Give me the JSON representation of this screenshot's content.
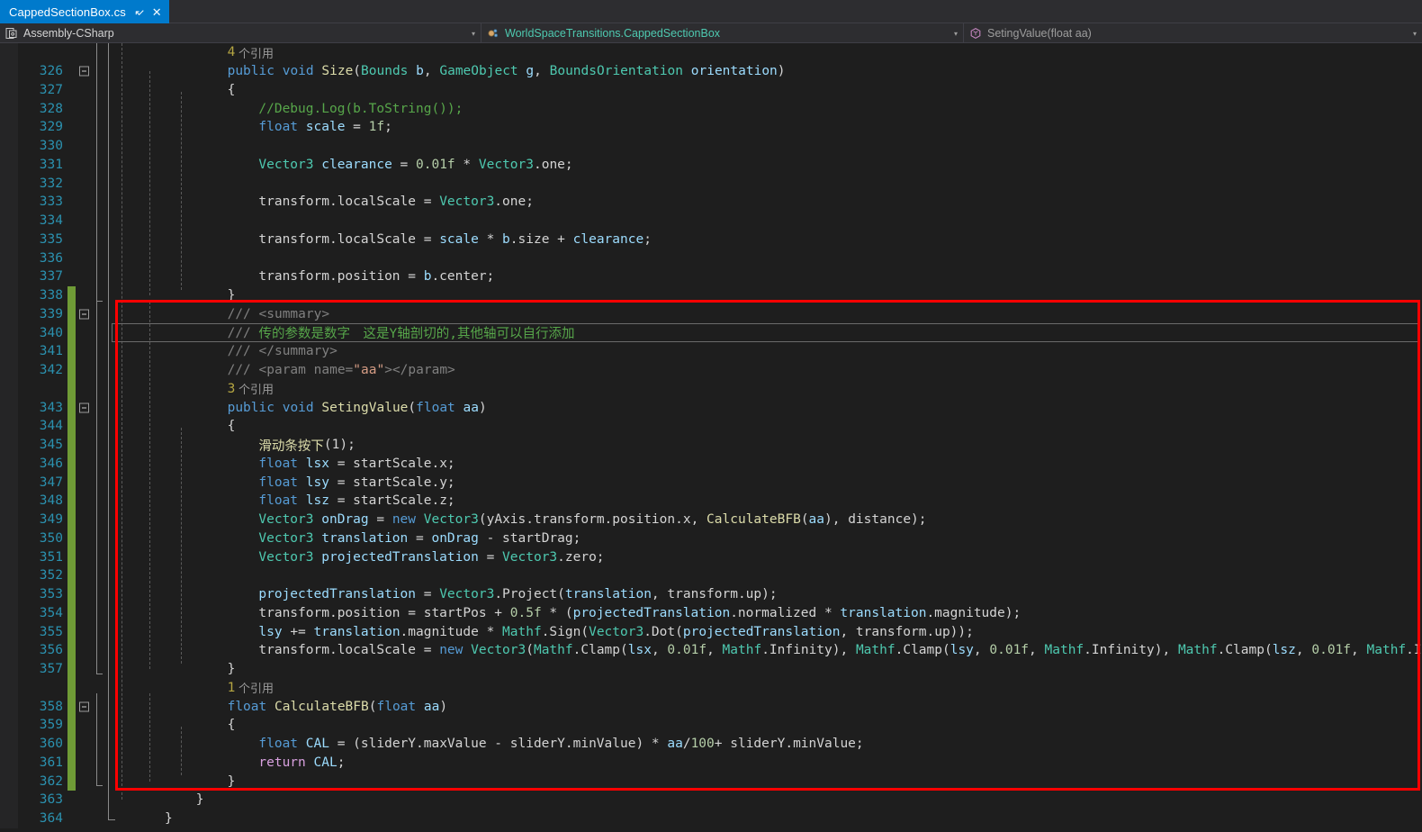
{
  "tab": {
    "label": "CappedSectionBox.cs",
    "pin_icon": "pin-icon",
    "close_icon": "close-icon",
    "close_glyph": "✕",
    "pin_glyph": "↲"
  },
  "navbar": {
    "project": "Assembly-CSharp",
    "type": "WorldSpaceTransitions.CappedSectionBox",
    "member": "SetingValue(float aa)",
    "dropdown_glyph": "▾"
  },
  "colors": {
    "accent": "#007acc",
    "chrome": "#2d2d30",
    "editor_bg": "#1e1e1e",
    "gutter_bg": "#252526",
    "line_number": "#2b91af",
    "annotation_red": "#ff0000",
    "change_green": "#6f9b36",
    "comment_green": "#57a64a",
    "keyword_blue": "#569cd6",
    "type_teal": "#4ec9b0",
    "method_tan": "#dcdcaa",
    "local_lightblue": "#9cdcfe",
    "number_olive": "#b5cea8",
    "string_salmon": "#d69d85",
    "control_violet": "#d8a0df"
  },
  "editor": {
    "first_visible_line": 326,
    "last_visible_line": 364,
    "lines": [
      {
        "n": "",
        "kind": "codelens",
        "text": "4 个引用",
        "count": "4",
        "indent": 2
      },
      {
        "n": "326",
        "kind": "code",
        "fold": true,
        "indent": 2,
        "tokens": [
          [
            "kw",
            "public"
          ],
          [
            "pln",
            " "
          ],
          [
            "kw",
            "void"
          ],
          [
            "pln",
            " "
          ],
          [
            "fn",
            "Size"
          ],
          [
            "pln",
            "("
          ],
          [
            "type",
            "Bounds"
          ],
          [
            "pln",
            " "
          ],
          [
            "var",
            "b"
          ],
          [
            "pln",
            ", "
          ],
          [
            "type",
            "GameObject"
          ],
          [
            "pln",
            " "
          ],
          [
            "var",
            "g"
          ],
          [
            "pln",
            ", "
          ],
          [
            "type",
            "BoundsOrientation"
          ],
          [
            "pln",
            " "
          ],
          [
            "var",
            "orientation"
          ],
          [
            "pln",
            ")"
          ]
        ]
      },
      {
        "n": "327",
        "kind": "code",
        "indent": 2,
        "tokens": [
          [
            "pln",
            "{"
          ]
        ]
      },
      {
        "n": "328",
        "kind": "code",
        "indent": 3,
        "tokens": [
          [
            "cmt",
            "//Debug.Log(b.ToString());"
          ]
        ]
      },
      {
        "n": "329",
        "kind": "code",
        "indent": 3,
        "tokens": [
          [
            "kw",
            "float"
          ],
          [
            "pln",
            " "
          ],
          [
            "var",
            "scale"
          ],
          [
            "pln",
            " = "
          ],
          [
            "num",
            "1f"
          ],
          [
            "pln",
            ";"
          ]
        ]
      },
      {
        "n": "330",
        "kind": "code",
        "indent": 3,
        "tokens": []
      },
      {
        "n": "331",
        "kind": "code",
        "indent": 3,
        "tokens": [
          [
            "type",
            "Vector3"
          ],
          [
            "pln",
            " "
          ],
          [
            "var",
            "clearance"
          ],
          [
            "pln",
            " = "
          ],
          [
            "num",
            "0.01f"
          ],
          [
            "pln",
            " * "
          ],
          [
            "type",
            "Vector3"
          ],
          [
            "pln",
            ".one;"
          ]
        ]
      },
      {
        "n": "332",
        "kind": "code",
        "indent": 3,
        "tokens": []
      },
      {
        "n": "333",
        "kind": "code",
        "indent": 3,
        "tokens": [
          [
            "pln",
            "transform.localScale = "
          ],
          [
            "type",
            "Vector3"
          ],
          [
            "pln",
            ".one;"
          ]
        ]
      },
      {
        "n": "334",
        "kind": "code",
        "indent": 3,
        "tokens": []
      },
      {
        "n": "335",
        "kind": "code",
        "indent": 3,
        "tokens": [
          [
            "pln",
            "transform.localScale = "
          ],
          [
            "var",
            "scale"
          ],
          [
            "pln",
            " * "
          ],
          [
            "var",
            "b"
          ],
          [
            "pln",
            ".size + "
          ],
          [
            "var",
            "clearance"
          ],
          [
            "pln",
            ";"
          ]
        ]
      },
      {
        "n": "336",
        "kind": "code",
        "indent": 3,
        "tokens": []
      },
      {
        "n": "337",
        "kind": "code",
        "indent": 3,
        "tokens": [
          [
            "pln",
            "transform.position = "
          ],
          [
            "var",
            "b"
          ],
          [
            "pln",
            ".center;"
          ]
        ]
      },
      {
        "n": "338",
        "kind": "code",
        "indent": 2,
        "tokens": [
          [
            "pln",
            "}"
          ]
        ]
      },
      {
        "n": "339",
        "kind": "code",
        "fold": true,
        "indent": 2,
        "tokens": [
          [
            "doctag",
            "/// "
          ],
          [
            "doctag",
            "<summary>"
          ]
        ]
      },
      {
        "n": "340",
        "kind": "code",
        "indent": 2,
        "current": true,
        "tokens": [
          [
            "doctag",
            "/// "
          ],
          [
            "doc",
            "传的参数是数字　这是Y轴剖切的,其他轴可以自行添加"
          ]
        ]
      },
      {
        "n": "341",
        "kind": "code",
        "indent": 2,
        "tokens": [
          [
            "doctag",
            "/// "
          ],
          [
            "doctag",
            "</summary>"
          ]
        ]
      },
      {
        "n": "342",
        "kind": "code",
        "indent": 2,
        "tokens": [
          [
            "doctag",
            "/// "
          ],
          [
            "doctag",
            "<param name="
          ],
          [
            "str",
            "\"aa\""
          ],
          [
            "doctag",
            ">"
          ],
          [
            "doctag",
            "</param>"
          ]
        ]
      },
      {
        "n": "",
        "kind": "codelens",
        "text": "3 个引用",
        "count": "3",
        "indent": 2
      },
      {
        "n": "343",
        "kind": "code",
        "fold": true,
        "indent": 2,
        "tokens": [
          [
            "kw",
            "public"
          ],
          [
            "pln",
            " "
          ],
          [
            "kw",
            "void"
          ],
          [
            "pln",
            " "
          ],
          [
            "fn",
            "SetingValue"
          ],
          [
            "pln",
            "("
          ],
          [
            "kw",
            "float"
          ],
          [
            "pln",
            " "
          ],
          [
            "var",
            "aa"
          ],
          [
            "pln",
            ")"
          ]
        ]
      },
      {
        "n": "344",
        "kind": "code",
        "indent": 2,
        "tokens": [
          [
            "pln",
            "{"
          ]
        ]
      },
      {
        "n": "345",
        "kind": "code",
        "indent": 3,
        "tokens": [
          [
            "fn",
            "滑动条按下"
          ],
          [
            "pln",
            "(1);"
          ]
        ]
      },
      {
        "n": "346",
        "kind": "code",
        "indent": 3,
        "tokens": [
          [
            "kw",
            "float"
          ],
          [
            "pln",
            " "
          ],
          [
            "var",
            "lsx"
          ],
          [
            "pln",
            " = startScale.x;"
          ]
        ]
      },
      {
        "n": "347",
        "kind": "code",
        "indent": 3,
        "tokens": [
          [
            "kw",
            "float"
          ],
          [
            "pln",
            " "
          ],
          [
            "var",
            "lsy"
          ],
          [
            "pln",
            " = startScale.y;"
          ]
        ]
      },
      {
        "n": "348",
        "kind": "code",
        "indent": 3,
        "tokens": [
          [
            "kw",
            "float"
          ],
          [
            "pln",
            " "
          ],
          [
            "var",
            "lsz"
          ],
          [
            "pln",
            " = startScale.z;"
          ]
        ]
      },
      {
        "n": "349",
        "kind": "code",
        "indent": 3,
        "tokens": [
          [
            "type",
            "Vector3"
          ],
          [
            "pln",
            " "
          ],
          [
            "var",
            "onDrag"
          ],
          [
            "pln",
            " = "
          ],
          [
            "kw",
            "new"
          ],
          [
            "pln",
            " "
          ],
          [
            "type",
            "Vector3"
          ],
          [
            "pln",
            "(yAxis.transform.position.x, "
          ],
          [
            "fn",
            "CalculateBFB"
          ],
          [
            "pln",
            "("
          ],
          [
            "var",
            "aa"
          ],
          [
            "pln",
            "), distance);"
          ]
        ]
      },
      {
        "n": "350",
        "kind": "code",
        "indent": 3,
        "tokens": [
          [
            "type",
            "Vector3"
          ],
          [
            "pln",
            " "
          ],
          [
            "var",
            "translation"
          ],
          [
            "pln",
            " = "
          ],
          [
            "var",
            "onDrag"
          ],
          [
            "pln",
            " - startDrag;"
          ]
        ]
      },
      {
        "n": "351",
        "kind": "code",
        "indent": 3,
        "tokens": [
          [
            "type",
            "Vector3"
          ],
          [
            "pln",
            " "
          ],
          [
            "var",
            "projectedTranslation"
          ],
          [
            "pln",
            " = "
          ],
          [
            "type",
            "Vector3"
          ],
          [
            "pln",
            ".zero;"
          ]
        ]
      },
      {
        "n": "352",
        "kind": "code",
        "indent": 3,
        "tokens": []
      },
      {
        "n": "353",
        "kind": "code",
        "indent": 3,
        "tokens": [
          [
            "var",
            "projectedTranslation"
          ],
          [
            "pln",
            " = "
          ],
          [
            "type",
            "Vector3"
          ],
          [
            "pln",
            ".Project("
          ],
          [
            "var",
            "translation"
          ],
          [
            "pln",
            ", transform.up);"
          ]
        ]
      },
      {
        "n": "354",
        "kind": "code",
        "indent": 3,
        "tokens": [
          [
            "pln",
            "transform.position = startPos + "
          ],
          [
            "num",
            "0.5f"
          ],
          [
            "pln",
            " * ("
          ],
          [
            "var",
            "projectedTranslation"
          ],
          [
            "pln",
            ".normalized * "
          ],
          [
            "var",
            "translation"
          ],
          [
            "pln",
            ".magnitude);"
          ]
        ]
      },
      {
        "n": "355",
        "kind": "code",
        "indent": 3,
        "tokens": [
          [
            "var",
            "lsy"
          ],
          [
            "pln",
            " += "
          ],
          [
            "var",
            "translation"
          ],
          [
            "pln",
            ".magnitude * "
          ],
          [
            "type",
            "Mathf"
          ],
          [
            "pln",
            ".Sign("
          ],
          [
            "type",
            "Vector3"
          ],
          [
            "pln",
            ".Dot("
          ],
          [
            "var",
            "projectedTranslation"
          ],
          [
            "pln",
            ", transform.up));"
          ]
        ]
      },
      {
        "n": "356",
        "kind": "code",
        "indent": 3,
        "tokens": [
          [
            "pln",
            "transform.localScale = "
          ],
          [
            "kw",
            "new"
          ],
          [
            "pln",
            " "
          ],
          [
            "type",
            "Vector3"
          ],
          [
            "pln",
            "("
          ],
          [
            "type",
            "Mathf"
          ],
          [
            "pln",
            ".Clamp("
          ],
          [
            "var",
            "lsx"
          ],
          [
            "pln",
            ", "
          ],
          [
            "num",
            "0.01f"
          ],
          [
            "pln",
            ", "
          ],
          [
            "type",
            "Mathf"
          ],
          [
            "pln",
            ".Infinity), "
          ],
          [
            "type",
            "Mathf"
          ],
          [
            "pln",
            ".Clamp("
          ],
          [
            "var",
            "lsy"
          ],
          [
            "pln",
            ", "
          ],
          [
            "num",
            "0.01f"
          ],
          [
            "pln",
            ", "
          ],
          [
            "type",
            "Mathf"
          ],
          [
            "pln",
            ".Infinity), "
          ],
          [
            "type",
            "Mathf"
          ],
          [
            "pln",
            ".Clamp("
          ],
          [
            "var",
            "lsz"
          ],
          [
            "pln",
            ", "
          ],
          [
            "num",
            "0.01f"
          ],
          [
            "pln",
            ", "
          ],
          [
            "type",
            "Mathf"
          ],
          [
            "pln",
            ".Infinity));"
          ]
        ]
      },
      {
        "n": "357",
        "kind": "code",
        "indent": 2,
        "tokens": [
          [
            "pln",
            "}"
          ]
        ]
      },
      {
        "n": "",
        "kind": "codelens",
        "text": "1 个引用",
        "count": "1",
        "indent": 2
      },
      {
        "n": "358",
        "kind": "code",
        "fold": true,
        "indent": 2,
        "tokens": [
          [
            "kw",
            "float"
          ],
          [
            "pln",
            " "
          ],
          [
            "fn",
            "CalculateBFB"
          ],
          [
            "pln",
            "("
          ],
          [
            "kw",
            "float"
          ],
          [
            "pln",
            " "
          ],
          [
            "var",
            "aa"
          ],
          [
            "pln",
            ")"
          ]
        ]
      },
      {
        "n": "359",
        "kind": "code",
        "indent": 2,
        "tokens": [
          [
            "pln",
            "{"
          ]
        ]
      },
      {
        "n": "360",
        "kind": "code",
        "indent": 3,
        "tokens": [
          [
            "kw",
            "float"
          ],
          [
            "pln",
            " "
          ],
          [
            "var",
            "CAL"
          ],
          [
            "pln",
            " = (sliderY.maxValue - sliderY.minValue) * "
          ],
          [
            "var",
            "aa"
          ],
          [
            "pln",
            "/"
          ],
          [
            "num",
            "100"
          ],
          [
            "pln",
            "+ sliderY.minValue;"
          ]
        ]
      },
      {
        "n": "361",
        "kind": "code",
        "indent": 3,
        "tokens": [
          [
            "ctl",
            "return"
          ],
          [
            "pln",
            " "
          ],
          [
            "var",
            "CAL"
          ],
          [
            "pln",
            ";"
          ]
        ]
      },
      {
        "n": "362",
        "kind": "code",
        "indent": 2,
        "tokens": [
          [
            "pln",
            "}"
          ]
        ]
      },
      {
        "n": "363",
        "kind": "code",
        "indent": 1,
        "tokens": [
          [
            "pln",
            "}"
          ]
        ]
      },
      {
        "n": "364",
        "kind": "code",
        "indent": 0,
        "tokens": [
          [
            "pln",
            "}"
          ]
        ]
      }
    ]
  },
  "annotation": {
    "type": "red-rectangle",
    "highlights_lines": "339-362"
  }
}
